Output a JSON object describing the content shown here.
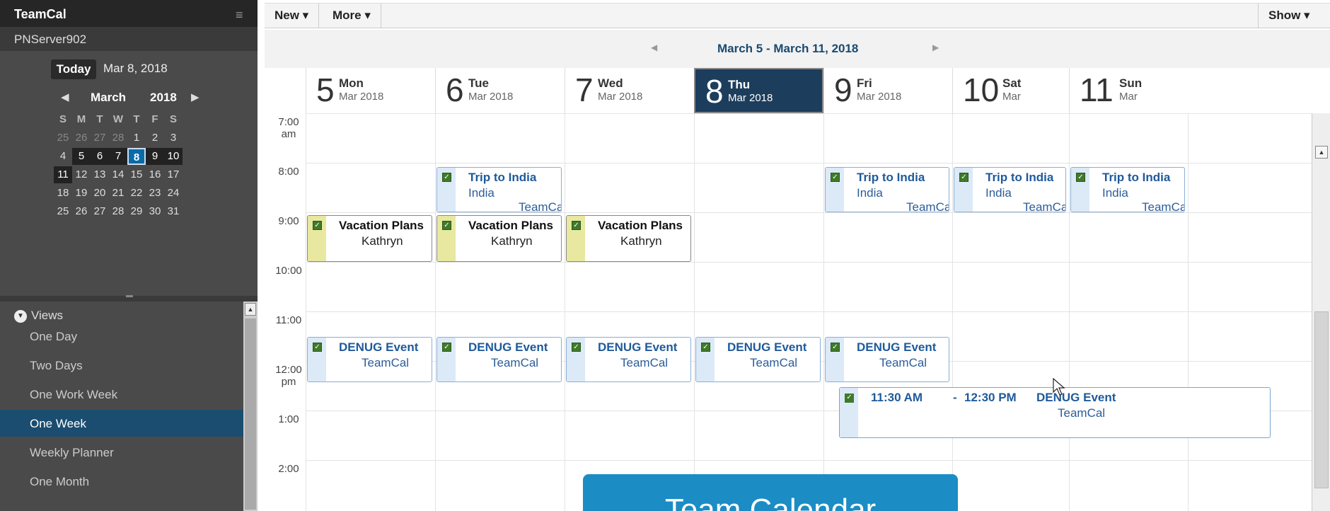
{
  "app": {
    "title": "TeamCal",
    "server": "PNServer902"
  },
  "mini_calendar": {
    "today_label": "Today",
    "today_date": "Mar 8, 2018",
    "month": "March",
    "year": "2018",
    "dow": [
      "S",
      "M",
      "T",
      "W",
      "T",
      "F",
      "S"
    ],
    "weeks": [
      [
        "25",
        "26",
        "27",
        "28",
        "1",
        "2",
        "3"
      ],
      [
        "4",
        "5",
        "6",
        "7",
        "8",
        "9",
        "10"
      ],
      [
        "11",
        "12",
        "13",
        "14",
        "15",
        "16",
        "17"
      ],
      [
        "18",
        "19",
        "20",
        "21",
        "22",
        "23",
        "24"
      ],
      [
        "25",
        "26",
        "27",
        "28",
        "29",
        "30",
        "31"
      ]
    ]
  },
  "views": {
    "header": "Views",
    "items": [
      "One Day",
      "Two Days",
      "One Work Week",
      "One Week",
      "Weekly Planner",
      "One Month"
    ],
    "active": "One Week"
  },
  "toolbar": {
    "new_label": "New ▾",
    "more_label": "More ▾",
    "show_label": "Show ▾"
  },
  "calendar": {
    "range": "March 5 - March 11, 2018",
    "days": [
      {
        "num": "5",
        "dow": "Mon",
        "sub": "Mar 2018"
      },
      {
        "num": "6",
        "dow": "Tue",
        "sub": "Mar 2018"
      },
      {
        "num": "7",
        "dow": "Wed",
        "sub": "Mar 2018"
      },
      {
        "num": "8",
        "dow": "Thu",
        "sub": "Mar 2018"
      },
      {
        "num": "9",
        "dow": "Fri",
        "sub": "Mar 2018"
      },
      {
        "num": "10",
        "dow": "Sat",
        "sub": "Mar"
      },
      {
        "num": "11",
        "dow": "Sun",
        "sub": "Mar"
      }
    ],
    "times": [
      {
        "a": "7:00",
        "b": "am"
      },
      {
        "a": "8:00",
        "b": ""
      },
      {
        "a": "9:00",
        "b": ""
      },
      {
        "a": "10:00",
        "b": ""
      },
      {
        "a": "11:00",
        "b": ""
      },
      {
        "a": "12:00",
        "b": "pm"
      },
      {
        "a": "1:00",
        "b": ""
      },
      {
        "a": "2:00",
        "b": ""
      }
    ],
    "events": {
      "trip_title": "Trip to India",
      "trip_loc": "India",
      "trip_cal": "TeamCal",
      "vac_title": "Vacation Plans",
      "vac_who": "Kathryn",
      "denug_title": "DENUG Event",
      "denug_cal": "TeamCal"
    },
    "drag_event": {
      "start": "11:30 AM",
      "sep": "-",
      "end": "12:30 PM",
      "title": "DENUG Event",
      "cal": "TeamCal"
    }
  },
  "overlay": {
    "label": "Team Calendar"
  }
}
